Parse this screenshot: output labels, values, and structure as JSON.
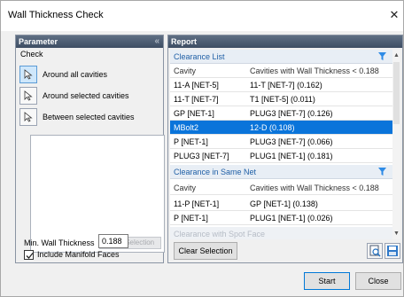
{
  "window": {
    "title": "Wall Thickness Check"
  },
  "parameter": {
    "header": "Parameter",
    "check_label": "Check",
    "options": [
      {
        "label": "Around all cavities",
        "selected": true
      },
      {
        "label": "Around selected cavities",
        "selected": false
      },
      {
        "label": "Between selected cavities",
        "selected": false
      }
    ],
    "clear_selection": "Clear Selection",
    "min_wall_label": "Min. Wall Thickness",
    "min_wall_value": "0.188",
    "include_manifold": "Include Manifold Faces",
    "include_manifold_checked": true
  },
  "report": {
    "header": "Report",
    "sections": [
      {
        "title": "Clearance List",
        "col1": "Cavity",
        "col2": "Cavities with Wall Thickness < 0.188",
        "rows": [
          {
            "cavity": "11-A [NET-5]",
            "detail": "11-T [NET-7] (0.162)"
          },
          {
            "cavity": "11-T [NET-7]",
            "detail": "T1 [NET-5] (0.011)"
          },
          {
            "cavity": "GP [NET-1]",
            "detail": "PLUG3 [NET-7] (0.126)"
          },
          {
            "cavity": "MBolt2",
            "detail": "12-D (0.108)",
            "selected": true
          },
          {
            "cavity": "P [NET-1]",
            "detail": "PLUG3 [NET-7] (0.066)"
          },
          {
            "cavity": "PLUG3 [NET-7]",
            "detail": "PLUG1 [NET-1] (0.181)"
          }
        ]
      },
      {
        "title": "Clearance in Same Net",
        "col1": "Cavity",
        "col2": "Cavities with Wall Thickness < 0.188",
        "rows": [
          {
            "cavity": "11-P [NET-1]",
            "detail": "GP [NET-1] (0.138)"
          },
          {
            "cavity": "P [NET-1]",
            "detail": "PLUG1 [NET-1] (0.026)"
          }
        ]
      }
    ],
    "dim_section": "Clearance with Spot Face",
    "clear_selection": "Clear Selection"
  },
  "buttons": {
    "start": "Start",
    "close": "Close"
  },
  "colors": {
    "selection": "#0a74da",
    "header": "#3d4d63",
    "section_text": "#1f5fa6"
  }
}
